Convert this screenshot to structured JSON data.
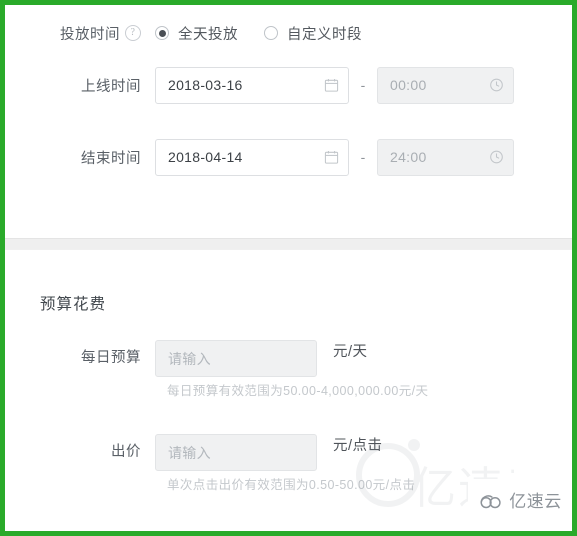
{
  "theme": {
    "border_green": "#2aaa2a",
    "label_color": "#5a6067",
    "hint_color": "#c4c8cc",
    "input_border": "#dddfe2",
    "disabled_bg": "#f0f1f2"
  },
  "time_section": {
    "delivery_time": {
      "label": "投放时间",
      "help_icon": "question-mark-icon",
      "options": [
        {
          "label": "全天投放",
          "selected": true
        },
        {
          "label": "自定义时段",
          "selected": false
        }
      ]
    },
    "start_time": {
      "label": "上线时间",
      "date_value": "2018-03-16",
      "date_icon": "calendar-icon",
      "separator": "-",
      "time_value": "00:00",
      "time_icon": "clock-icon"
    },
    "end_time": {
      "label": "结束时间",
      "date_value": "2018-04-14",
      "date_icon": "calendar-icon",
      "separator": "-",
      "time_value": "24:00",
      "time_icon": "clock-icon"
    }
  },
  "budget_section": {
    "title": "预算花费",
    "daily_budget": {
      "label": "每日预算",
      "placeholder": "请输入",
      "value": "",
      "unit": "元/天",
      "hint": "每日预算有效范围为50.00-4,000,000.00元/天"
    },
    "bid_price": {
      "label": "出价",
      "placeholder": "请输入",
      "value": "",
      "unit": "元/点击",
      "hint": "单次点击出价有效范围为0.50-50.00元/点击"
    }
  },
  "watermark": {
    "brand": "亿速云",
    "logo_icon": "cloud-logo-icon"
  }
}
